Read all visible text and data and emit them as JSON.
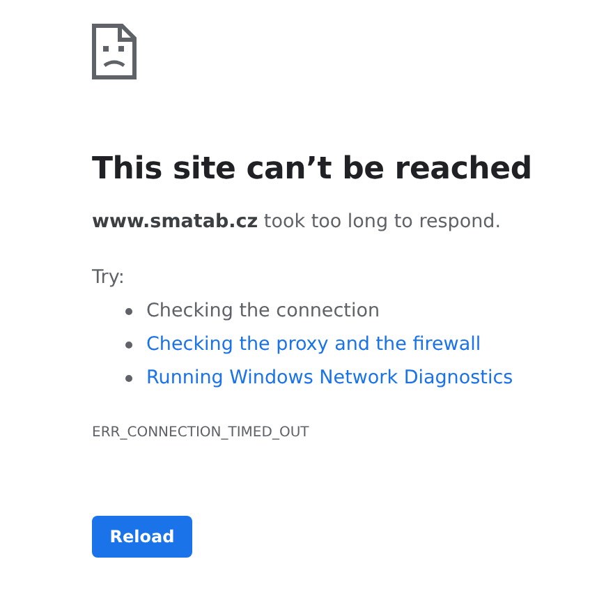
{
  "heading": "This site can’t be reached",
  "message": "**www.smatab.cz** took too long to respond.",
  "try_label": "Try:",
  "suggestions": [
    {
      "kind": "text",
      "label": "Checking the connection"
    },
    {
      "kind": "link",
      "label": "Checking the proxy and the firewall"
    },
    {
      "kind": "link",
      "label": "Running Windows Network Diagnostics"
    }
  ],
  "error_code": "ERR_CONNECTION_TIMED_OUT",
  "button": "Reload"
}
